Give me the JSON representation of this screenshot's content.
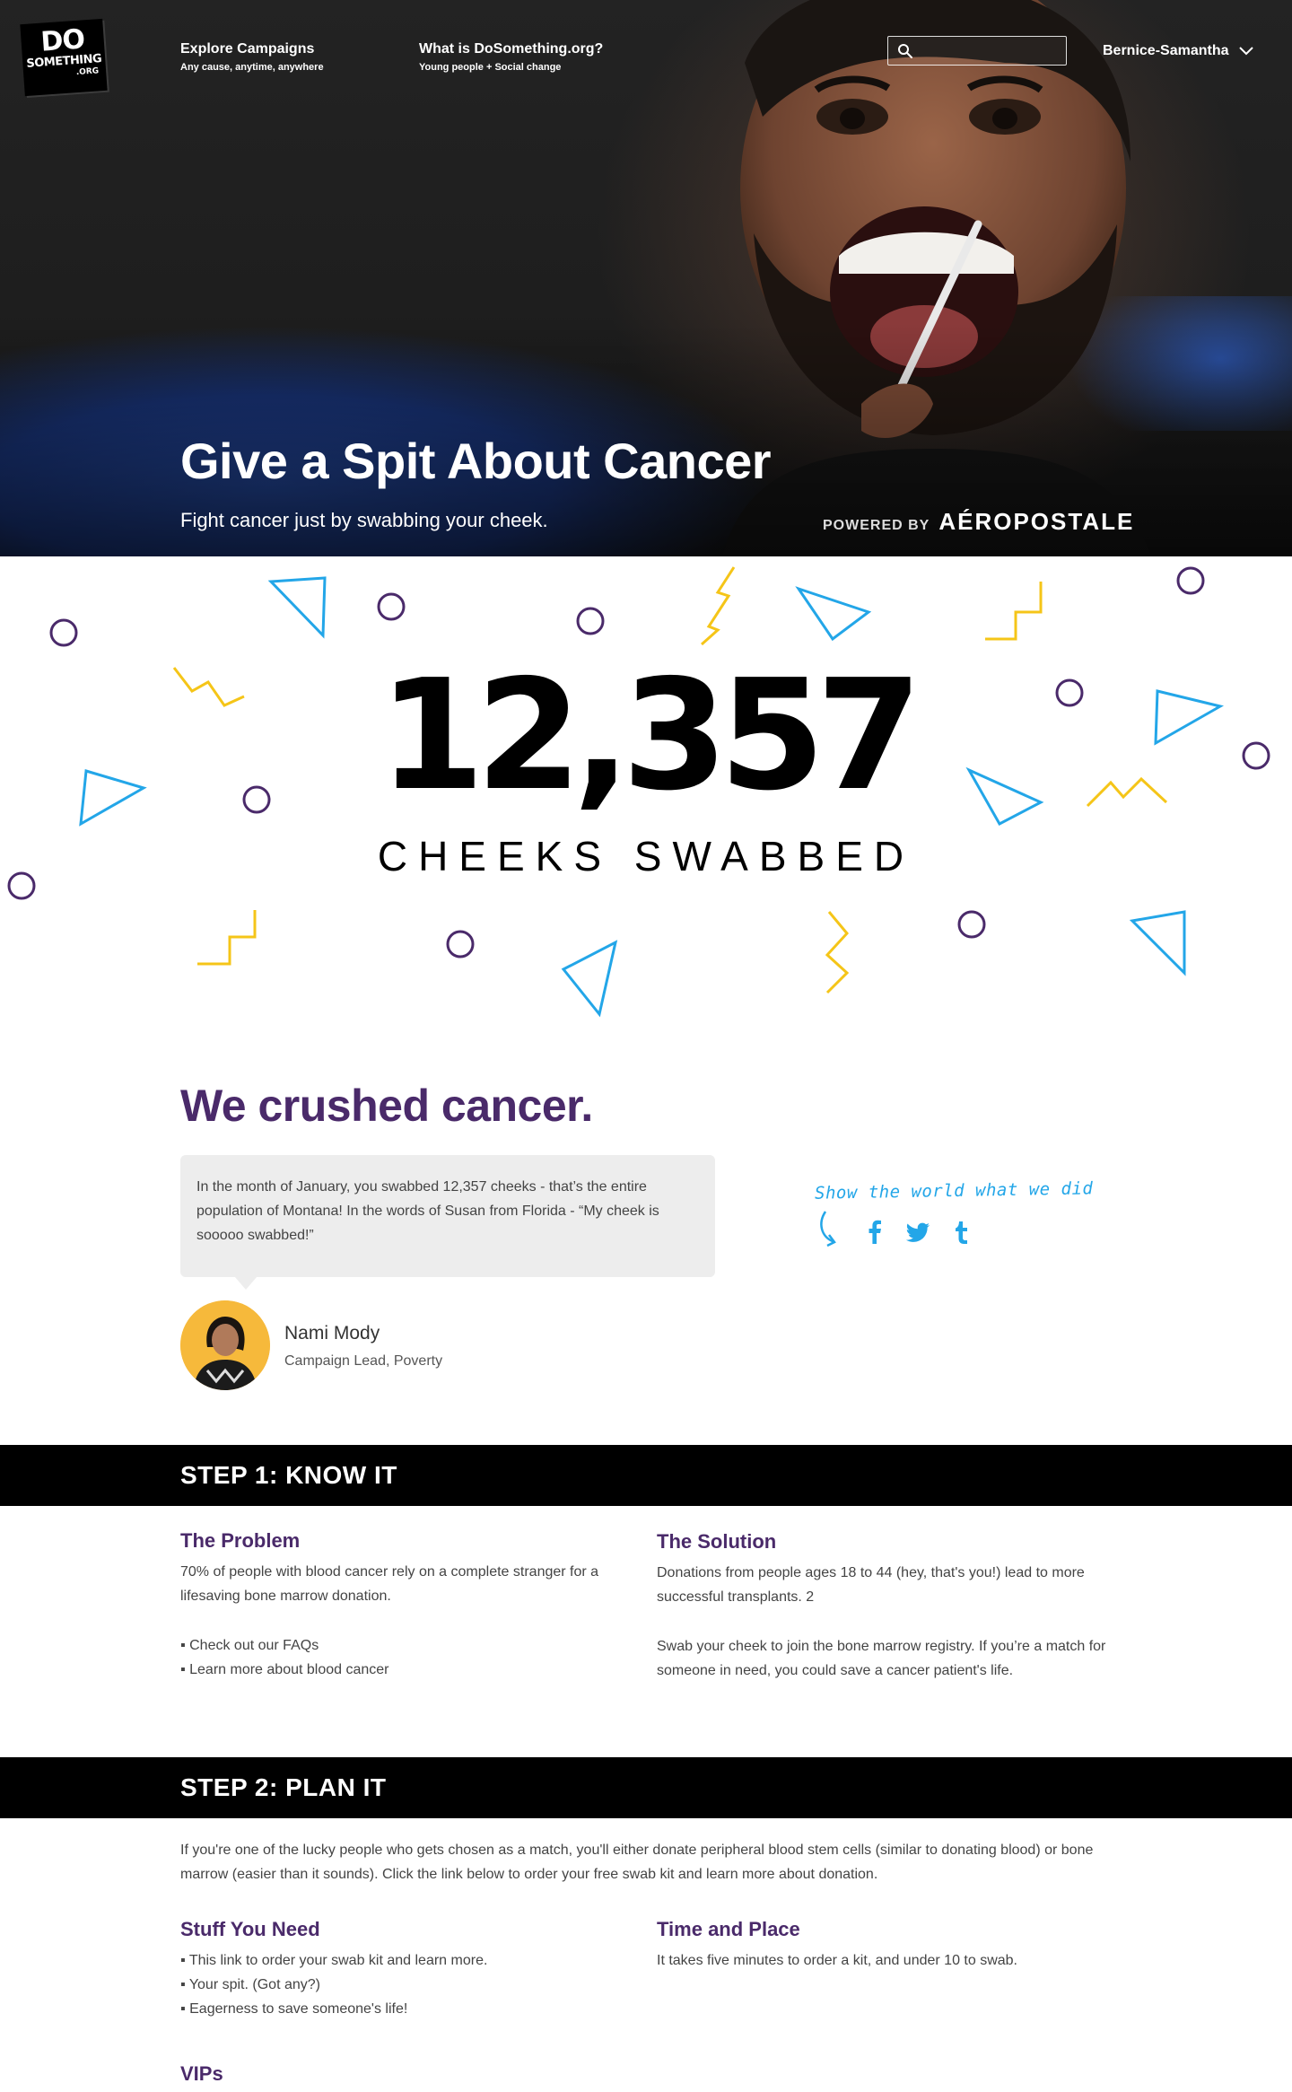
{
  "logo": {
    "line1": "DO",
    "line2": "SOMETHING",
    "line3": ".ORG"
  },
  "nav": {
    "explore": {
      "title": "Explore Campaigns",
      "subtitle": "Any cause, anytime, anywhere"
    },
    "about": {
      "title": "What is DoSomething.org?",
      "subtitle": "Young people + Social change"
    },
    "search": {
      "placeholder": "",
      "value": ""
    },
    "user": "Bernice-Samantha"
  },
  "hero": {
    "title": "Give a Spit About Cancer",
    "subtitle": "Fight cancer just by swabbing your cheek.",
    "powered_by": "POWERED BY",
    "sponsor": "AÉROPOSTALE"
  },
  "counter": {
    "value": "12,357",
    "label": "CHEEKS SWABBED"
  },
  "result": {
    "heading": "We crushed cancer.",
    "quote": "In the month of January, you swabbed 12,357 cheeks - that’s the entire population of Montana! In the words of Susan from Florida - “My cheek is sooooo swabbed!”",
    "lead_name": "Nami Mody",
    "lead_role": "Campaign Lead, Poverty",
    "share_text": "Show the world what we did"
  },
  "step1": {
    "title": "STEP 1: KNOW IT",
    "problem_heading": "The Problem",
    "problem_text": "70% of people with blood cancer rely on a complete stranger for a lifesaving bone marrow donation.",
    "links": [
      "Check out our FAQs",
      "Learn more about blood cancer"
    ],
    "solution_heading": "The Solution",
    "solution_text1": "Donations from people ages 18 to 44 (hey, that's you!) lead to more successful transplants. 2",
    "solution_text2": "Swab your cheek to join the bone marrow registry. If you’re a match for someone in need, you could save a cancer patient's life."
  },
  "step2": {
    "title": "STEP 2: PLAN IT",
    "intro": "If you're one of the lucky people who gets chosen as a match, you'll either donate peripheral blood stem cells (similar to donating blood) or bone marrow (easier than it sounds). Click the link below to order your free swab kit and learn more about donation.",
    "stuff_heading": "Stuff You Need",
    "stuff_items": [
      "This link to order your swab kit and learn more.",
      "Your spit. (Got any?)",
      "Eagerness to save someone's life!"
    ],
    "time_heading": "Time and Place",
    "time_text": "It takes five minutes to order a kit, and under 10 to swab.",
    "vips_heading": "VIPs"
  },
  "colors": {
    "purple": "#4a2a6a",
    "blue": "#23a6e8",
    "yellow": "#f5c518",
    "black": "#000000"
  },
  "icons": [
    "search-icon",
    "chevron-down-icon",
    "facebook-icon",
    "twitter-icon",
    "tumblr-icon",
    "curved-arrow-icon"
  ]
}
